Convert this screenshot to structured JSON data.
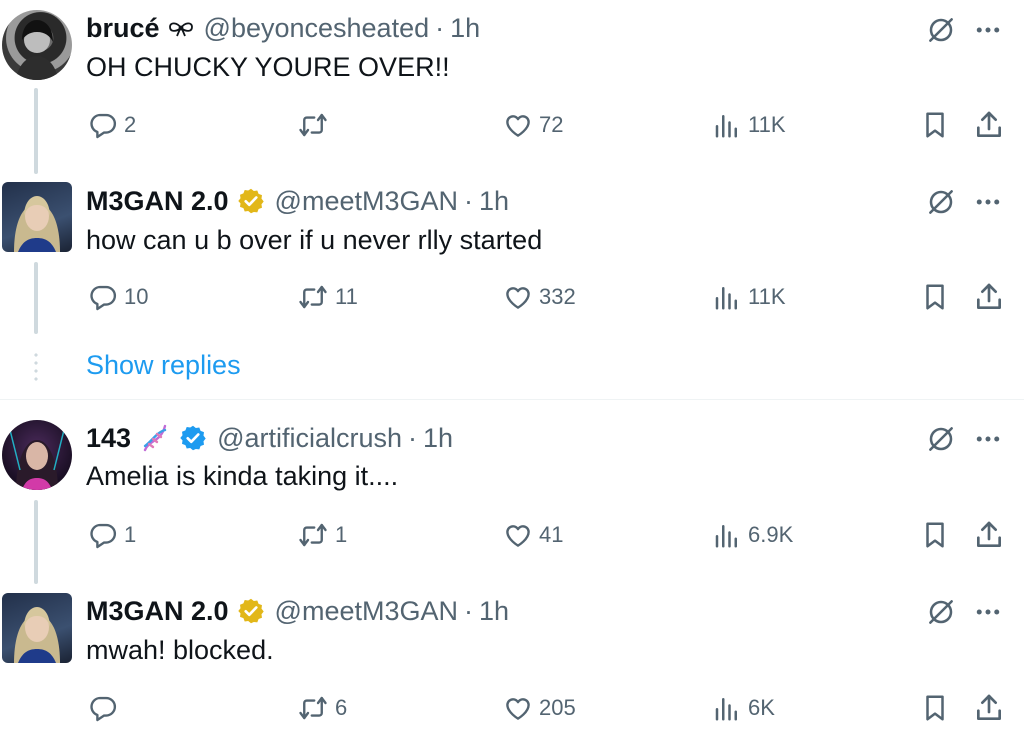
{
  "posts": [
    {
      "name": "brucé",
      "handle": "@beyoncesheated",
      "sep": "·",
      "time": "1h",
      "text": "OH CHUCKY YOURE OVER!!",
      "replies": "2",
      "reposts": "",
      "likes": "72",
      "views": "11K",
      "badge": "none",
      "icon_after_name": "bow-icon"
    },
    {
      "name": "M3GAN 2.0",
      "handle": "@meetM3GAN",
      "sep": "·",
      "time": "1h",
      "text": "how can u b over if u never rlly started",
      "replies": "10",
      "reposts": "11",
      "likes": "332",
      "views": "11K",
      "badge": "gold-verified"
    },
    {
      "name": "143",
      "handle": "@artificialcrush",
      "sep": "·",
      "time": "1h",
      "text": "Amelia is kinda taking it....",
      "replies": "1",
      "reposts": "1",
      "likes": "41",
      "views": "6.9K",
      "badge": "blue-verified",
      "icon_after_name": "dna-emoji"
    },
    {
      "name": "M3GAN 2.0",
      "handle": "@meetM3GAN",
      "sep": "·",
      "time": "1h",
      "text": "mwah! blocked.",
      "replies": "",
      "reposts": "6",
      "likes": "205",
      "views": "6K",
      "badge": "gold-verified"
    }
  ],
  "show_replies": "Show replies",
  "colors": {
    "text": "#0f1419",
    "muted": "#536471",
    "link": "#1d9bf0",
    "gold": "#e2b719",
    "blue": "#1d9bf0",
    "line": "#cfd9de"
  }
}
